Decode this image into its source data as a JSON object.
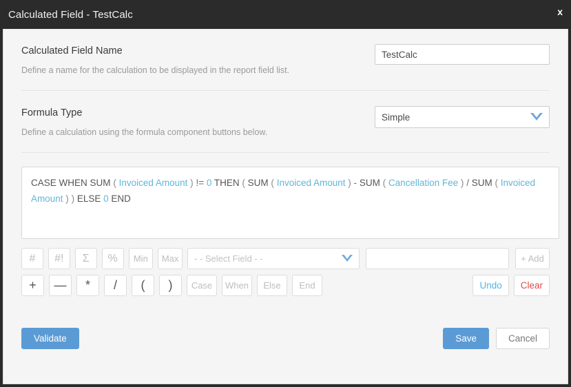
{
  "titlebar": {
    "title": "Calculated Field - TestCalc",
    "close_label": "x"
  },
  "name_section": {
    "label": "Calculated Field Name",
    "help": "Define a name for the calculation to be displayed in the report field list.",
    "value": "TestCalc",
    "placeholder": ""
  },
  "formula_type_section": {
    "label": "Formula Type",
    "help": "Define a calculation using the formula component buttons below.",
    "selected": "Simple",
    "options": [
      "Simple"
    ]
  },
  "formula": {
    "tokens": [
      {
        "text": "CASE",
        "type": "kw"
      },
      {
        "text": "WHEN",
        "type": "kw"
      },
      {
        "text": "SUM",
        "type": "kw"
      },
      {
        "text": "(",
        "type": "paren"
      },
      {
        "text": "Invoiced Amount",
        "type": "field"
      },
      {
        "text": ")",
        "type": "paren"
      },
      {
        "text": "!=",
        "type": "op"
      },
      {
        "text": "0",
        "type": "num"
      },
      {
        "text": "THEN",
        "type": "kw"
      },
      {
        "text": "(",
        "type": "paren"
      },
      {
        "text": "SUM",
        "type": "kw"
      },
      {
        "text": "(",
        "type": "paren"
      },
      {
        "text": "Invoiced Amount",
        "type": "field"
      },
      {
        "text": ")",
        "type": "paren"
      },
      {
        "text": "-",
        "type": "op"
      },
      {
        "text": "SUM",
        "type": "kw"
      },
      {
        "text": "(",
        "type": "paren"
      },
      {
        "text": "Cancellation Fee",
        "type": "field"
      },
      {
        "text": ")",
        "type": "paren"
      },
      {
        "text": "/",
        "type": "op"
      },
      {
        "text": "SUM",
        "type": "kw"
      },
      {
        "text": "(",
        "type": "paren"
      },
      {
        "text": "Invoiced Amount",
        "type": "field"
      },
      {
        "text": ")",
        "type": "paren"
      },
      {
        "text": ")",
        "type": "paren"
      },
      {
        "text": "ELSE",
        "type": "kw"
      },
      {
        "text": "0",
        "type": "num"
      },
      {
        "text": "END",
        "type": "kw"
      }
    ],
    "plain_text": "CASE WHEN SUM ( Invoiced Amount ) != 0 THEN ( SUM ( Invoiced Amount ) - SUM ( Cancellation Fee ) / SUM ( Invoiced Amount ) ) ELSE 0 END"
  },
  "toolbar_row1": {
    "buttons": [
      {
        "label": "#",
        "name": "number-button",
        "style": "sym"
      },
      {
        "label": "#!",
        "name": "number-not-button",
        "style": "sym"
      },
      {
        "label": "Σ",
        "name": "sum-sigma-button",
        "style": "sym"
      },
      {
        "label": "%",
        "name": "percent-button",
        "style": "sym"
      },
      {
        "label": "Min",
        "name": "min-button",
        "style": "word"
      },
      {
        "label": "Max",
        "name": "max-button",
        "style": "word"
      }
    ],
    "field_select_placeholder": "- - Select Field - -",
    "value_input_value": "",
    "value_input_placeholder": "",
    "add_label": "+ Add"
  },
  "toolbar_row2": {
    "buttons": [
      {
        "label": "+",
        "name": "plus-button",
        "style": "dark"
      },
      {
        "label": "—",
        "name": "minus-button",
        "style": "dark"
      },
      {
        "label": "*",
        "name": "multiply-button",
        "style": "dark"
      },
      {
        "label": "/",
        "name": "divide-button",
        "style": "dark"
      },
      {
        "label": "(",
        "name": "open-paren-button",
        "style": "dark"
      },
      {
        "label": ")",
        "name": "close-paren-button",
        "style": "dark"
      },
      {
        "label": "Case",
        "name": "case-button",
        "style": "word"
      },
      {
        "label": "When",
        "name": "when-button",
        "style": "word"
      },
      {
        "label": "Else",
        "name": "else-button",
        "style": "word"
      },
      {
        "label": "End",
        "name": "end-button",
        "style": "word"
      }
    ],
    "undo_label": "Undo",
    "clear_label": "Clear"
  },
  "footer": {
    "validate_label": "Validate",
    "save_label": "Save",
    "cancel_label": "Cancel"
  },
  "colors": {
    "titlebar_bg": "#2b2b2b",
    "dialog_bg": "#f5f5f5",
    "accent_blue": "#5b9bd5",
    "field_token_blue": "#61b6d9",
    "undo_blue": "#51b3e0",
    "clear_red": "#e04a4a"
  }
}
